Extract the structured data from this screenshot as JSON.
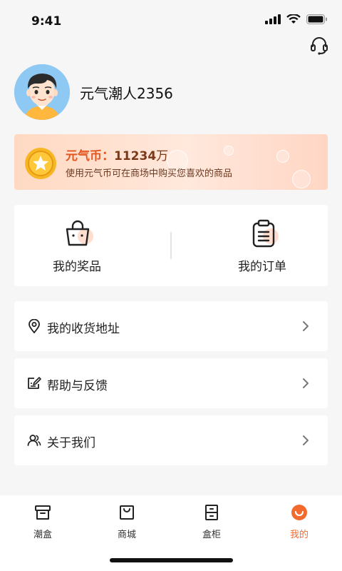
{
  "status_bar": {
    "time": "9:41"
  },
  "profile": {
    "username": "元气潮人2356"
  },
  "coin_card": {
    "title_label": "元气币：",
    "value": "11234",
    "unit": "万",
    "description": "使用元气币可在商场中购买您喜欢的商品"
  },
  "quick_actions": [
    {
      "label": "我的奖品",
      "icon": "bag-icon"
    },
    {
      "label": "我的订单",
      "icon": "clipboard-icon"
    }
  ],
  "menu": [
    {
      "label": "我的收货地址",
      "icon": "location-icon"
    },
    {
      "label": "帮助与反馈",
      "icon": "edit-note-icon"
    },
    {
      "label": "关于我们",
      "icon": "users-icon"
    }
  ],
  "tabs": [
    {
      "label": "潮盒",
      "icon": "box-icon",
      "active": false
    },
    {
      "label": "商城",
      "icon": "shopping-bag-icon",
      "active": false
    },
    {
      "label": "盒柜",
      "icon": "cabinet-icon",
      "active": false
    },
    {
      "label": "我的",
      "icon": "smile-icon",
      "active": true
    }
  ],
  "colors": {
    "accent": "#f26a2e",
    "coin_title": "#e3561f",
    "card_bg": "#ffe4d4"
  }
}
